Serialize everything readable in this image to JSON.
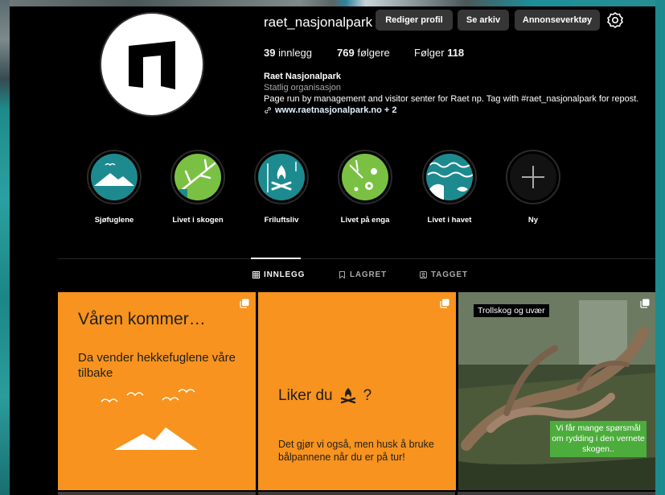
{
  "profile": {
    "username": "raet_nasjonalpark",
    "buttons": {
      "edit": "Rediger profil",
      "archive": "Se arkiv",
      "ads": "Annonseverktøy"
    },
    "stats": {
      "posts_count": "39",
      "posts_label": "innlegg",
      "followers_count": "769",
      "followers_label": "følgere",
      "following_label": "Følger",
      "following_count": "118"
    },
    "bio": {
      "name": "Raet Nasjonalpark",
      "category": "Statlig organisasjon",
      "text": "Page run by management and visitor senter for Raet np. Tag with #raet_nasjonalpark for repost.",
      "link": "www.raetnasjonalpark.no + 2"
    }
  },
  "highlights": [
    {
      "label": "Sjøfuglene",
      "icon": "mountain-icon"
    },
    {
      "label": "Livet i skogen",
      "icon": "branch-icon"
    },
    {
      "label": "Friluftsliv",
      "icon": "campfire-icon"
    },
    {
      "label": "Livet på enga",
      "icon": "flowers-icon"
    },
    {
      "label": "Livet i havet",
      "icon": "waves-icon"
    },
    {
      "label": "Ny",
      "icon": "plus-icon"
    }
  ],
  "tabs": {
    "posts": "INNLEGG",
    "saved": "LAGRET",
    "tagged": "TAGGET"
  },
  "posts": {
    "p1": {
      "title": "Våren kommer…",
      "body": "Da vender hekkefuglene våre tilbake"
    },
    "p2": {
      "title": "Liker du",
      "title_end": "?",
      "body": "Det gjør vi også, men husk å bruke bålpannene når du er på tur!"
    },
    "p3": {
      "label": "Trollskog og uvær",
      "caption": "Vi får mange spørsmål om rydding i den vernete skogen.."
    }
  },
  "colors": {
    "accent_orange": "#f7931e",
    "teal": "#1d8a8f",
    "green": "#7ac143",
    "button": "#363636"
  }
}
